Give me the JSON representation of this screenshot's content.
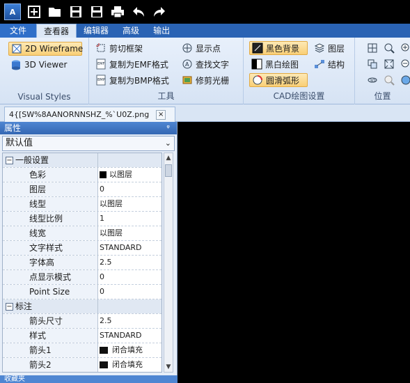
{
  "qat": {
    "logo_text": "A",
    "icons": [
      "new-icon",
      "open-icon",
      "save-icon",
      "save-pdf-icon",
      "print-icon",
      "undo-icon",
      "redo-icon"
    ]
  },
  "ribbon_tabs": [
    "文件",
    "查看器",
    "编辑器",
    "高级",
    "输出"
  ],
  "groups": {
    "visual_styles": {
      "title": "Visual Styles",
      "wireframe": "2D Wireframe",
      "viewer3d": "3D Viewer"
    },
    "tools": {
      "title": "工具",
      "clip": "剪切框架",
      "emf": "复制为EMF格式",
      "bmp": "复制为BMP格式",
      "points": "显示点",
      "findtext": "查找文字",
      "trim": "修剪光栅"
    },
    "cad": {
      "title": "CAD绘图设置",
      "blackbg": "黑色背景",
      "bw": "黑白绘图",
      "arc": "圆滑弧形",
      "layers": "图层",
      "structure": "结构"
    },
    "position": {
      "title": "位置"
    }
  },
  "doc_tab": {
    "title": "4{[SW%8AANORNNSHZ_%`U0Z.png",
    "close": "×"
  },
  "properties": {
    "header": "属性",
    "pin": "ᵠ",
    "dropdown_value": "默认值",
    "general": {
      "category": "一般设置",
      "rows": [
        {
          "k": "色彩",
          "v": "以图层"
        },
        {
          "k": "图层",
          "v": "0"
        },
        {
          "k": "线型",
          "v": "以图层"
        },
        {
          "k": "线型比例",
          "v": "1"
        },
        {
          "k": "线宽",
          "v": "以图层"
        },
        {
          "k": "文字样式",
          "v": "STANDARD"
        },
        {
          "k": "字体高",
          "v": "2.5"
        },
        {
          "k": "点显示模式",
          "v": "0"
        },
        {
          "k": "Point Size",
          "v": "0"
        }
      ]
    },
    "dim": {
      "category": "标注",
      "rows": [
        {
          "k": "箭头尺寸",
          "v": "2.5"
        },
        {
          "k": "样式",
          "v": "STANDARD"
        },
        {
          "k": "箭头1",
          "v": "闭合填充"
        },
        {
          "k": "箭头2",
          "v": "闭合填充"
        }
      ]
    },
    "footer": "收藏夹"
  }
}
